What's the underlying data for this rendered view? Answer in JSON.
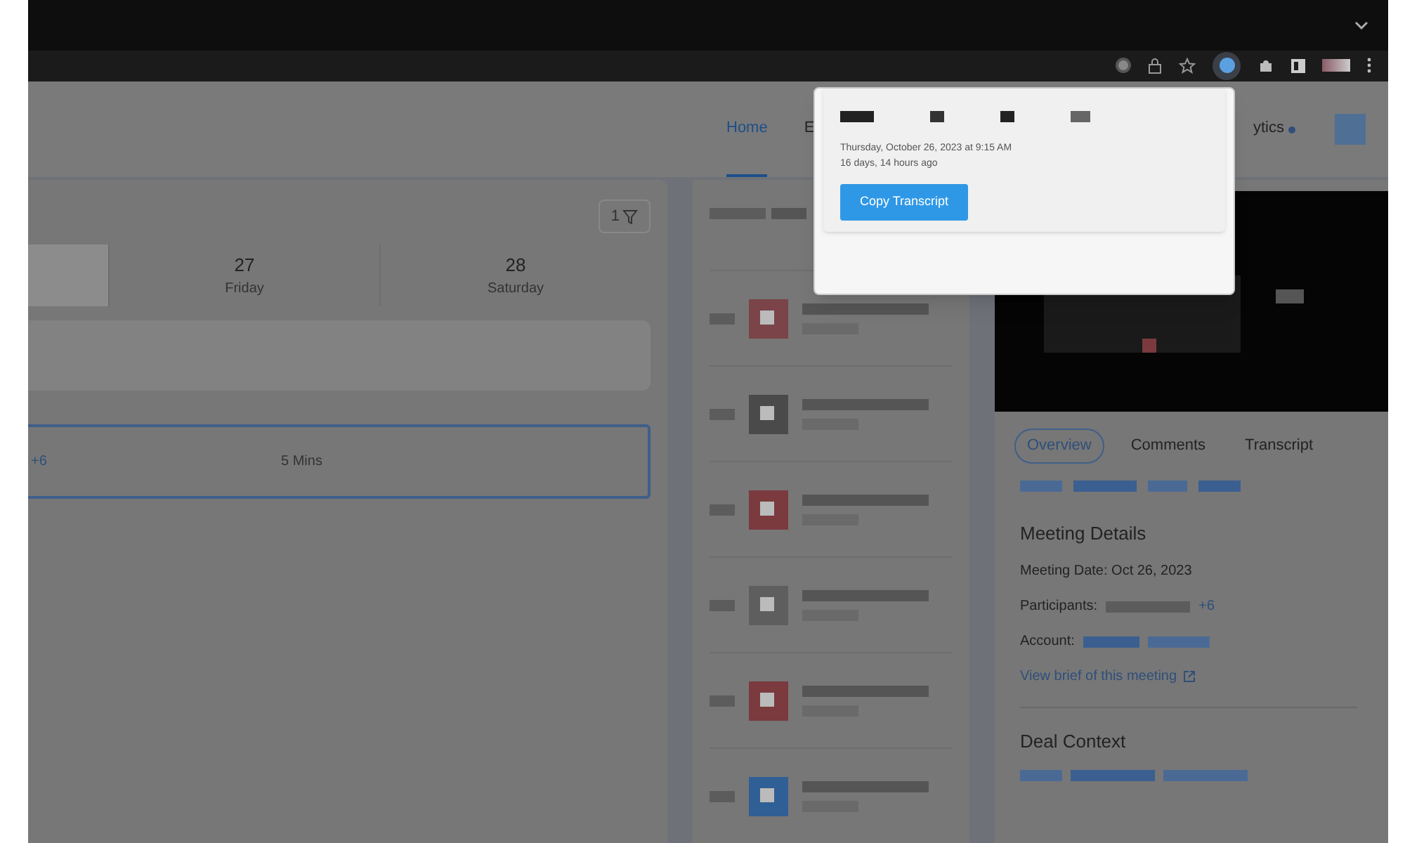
{
  "nav": {
    "tabs": [
      {
        "label": "Home",
        "selected": true,
        "dot": false
      },
      {
        "label": "E",
        "selected": false,
        "dot": false
      },
      {
        "label": "ytics",
        "selected": false,
        "dot": true
      }
    ]
  },
  "calendar": {
    "filter_count": "1",
    "days": [
      {
        "selected": true
      },
      {
        "number": "27",
        "weekday": "Friday",
        "selected": false
      },
      {
        "number": "28",
        "weekday": "Saturday",
        "selected": false
      }
    ],
    "meeting": {
      "more": "+6",
      "duration": "5 Mins"
    }
  },
  "meeting_list": {
    "rows": [
      {
        "color": "#7a4448"
      },
      {
        "color": "#4a4a4a"
      },
      {
        "color": "#7a3a3e"
      },
      {
        "color": "#5e5e5e"
      },
      {
        "color": "#7a3a3e"
      },
      {
        "color": "#2f5f95"
      }
    ]
  },
  "detail": {
    "tabs": [
      {
        "label": "Overview",
        "selected": true
      },
      {
        "label": "Comments",
        "selected": false
      },
      {
        "label": "Transcript",
        "selected": false
      }
    ],
    "section_title": "Meeting Details",
    "meeting_date": "Meeting Date: Oct 26, 2023",
    "participants_label": "Participants:",
    "participants_more": "+6",
    "account_label": "Account:",
    "brief_link": "View brief of this meeting",
    "deal_title": "Deal Context"
  },
  "popup": {
    "date": "Thursday, October 26, 2023 at 9:15 AM",
    "ago": "16 days, 14 hours ago",
    "button": "Copy Transcript"
  }
}
